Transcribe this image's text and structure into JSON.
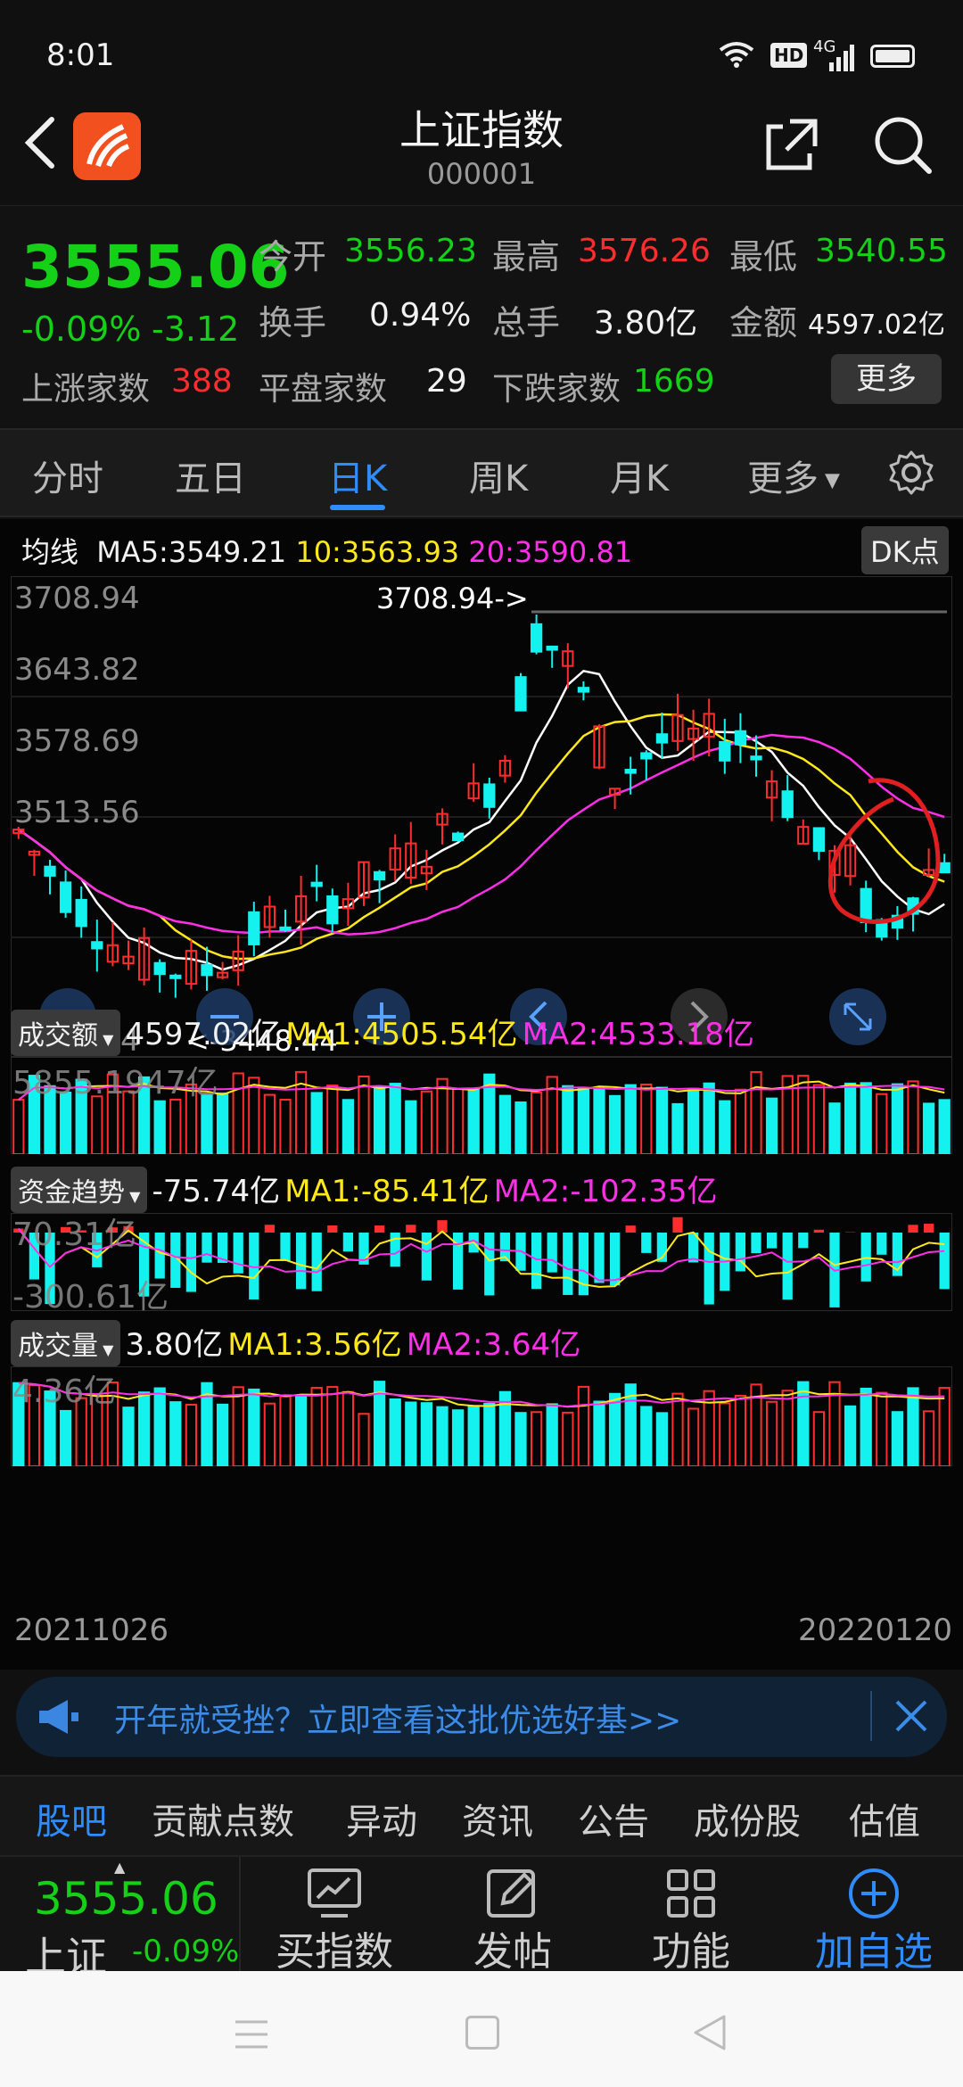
{
  "status": {
    "time": "8:01",
    "hd": "HD",
    "network": "4G"
  },
  "header": {
    "title": "上证指数",
    "code": "000001"
  },
  "quote": {
    "price": "3555.06",
    "change_pct": "-0.09%",
    "change": "-3.12",
    "open_label": "今开",
    "open": "3556.23",
    "high_label": "最高",
    "high": "3576.26",
    "low_label": "最低",
    "low": "3540.55",
    "turnover_label": "换手",
    "turnover": "0.94%",
    "volume_label": "总手",
    "volume": "3.80亿",
    "amount_label": "金额",
    "amount": "4597.02亿",
    "up_label": "上涨家数",
    "up": "388",
    "flat_label": "平盘家数",
    "flat": "29",
    "down_label": "下跌家数",
    "down": "1669",
    "more_button": "更多"
  },
  "tabs": [
    "分时",
    "五日",
    "日K",
    "周K",
    "月K",
    "更多"
  ],
  "active_tab": "日K",
  "ma_bar": {
    "label": "均线",
    "ma5": "MA5:3549.21",
    "ma10": "10:3563.93",
    "ma20": "20:3590.81",
    "dk_button": "DK点"
  },
  "kline": {
    "y_labels": [
      "3708.94",
      "3643.82",
      "3578.69",
      "3513.56",
      "3448.44"
    ],
    "high_marker": "3708.94->",
    "low_marker": "<-3448.44",
    "date_start": "20211026",
    "date_end": "20220120"
  },
  "amount_panel": {
    "label": "成交额",
    "value": "4597.02亿",
    "ma1": "MA1:4505.54亿",
    "ma2": "MA2:4533.18亿",
    "max_label": "5855.1947亿"
  },
  "flow_panel": {
    "label": "资金趋势",
    "value": "-75.74亿",
    "ma1": "MA1:-85.41亿",
    "ma2": "MA2:-102.35亿",
    "max_label": "70.31亿",
    "min_label": "-300.61亿"
  },
  "volume_panel": {
    "label": "成交量",
    "value": "3.80亿",
    "ma1": "MA1:3.56亿",
    "ma2": "MA2:3.64亿",
    "max_label": "4.36亿"
  },
  "banner": {
    "text": "开年就受挫？立即查看这批优选好基>>"
  },
  "subtabs": [
    "股吧",
    "贡献点数",
    "异动",
    "资讯",
    "公告",
    "成份股",
    "估值"
  ],
  "active_subtab": "股吧",
  "toolbar": {
    "price": "3555.06",
    "name": "上证",
    "pct": "-0.09%",
    "buy_label": "买指数",
    "post_label": "发帖",
    "func_label": "功能",
    "add_label": "加自选"
  },
  "colors": {
    "up": "#ff2d2d",
    "down": "#14d016",
    "cyan": "#14f2ef",
    "accent": "#2f8cff",
    "ma5": "#ffffff",
    "ma10": "#ffe81a",
    "ma20": "#ff2fe8"
  }
}
